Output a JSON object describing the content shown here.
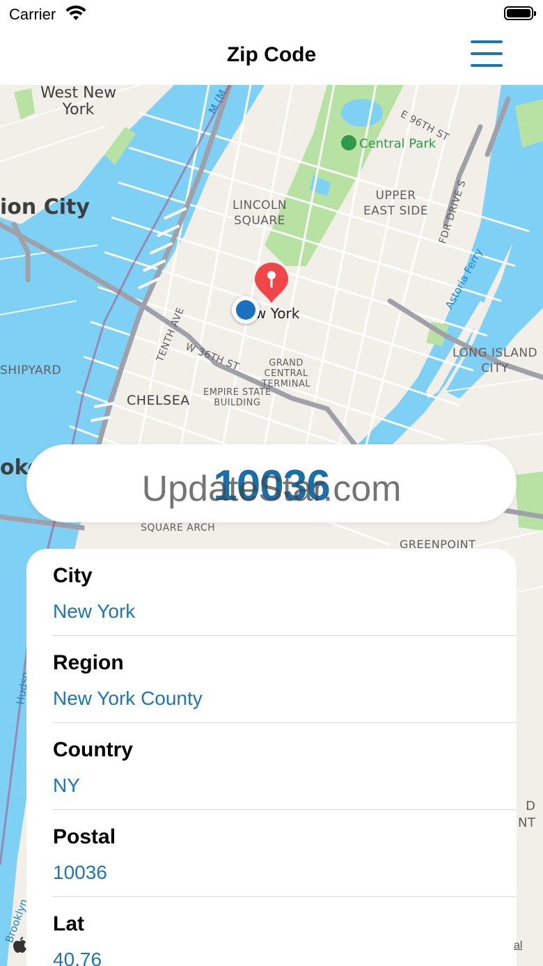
{
  "status_bar": {
    "carrier": "Carrier"
  },
  "navbar": {
    "title": "Zip Code"
  },
  "map": {
    "labels": {
      "west_new_york": "West New\nYork",
      "union_city": "ion City",
      "shipyard": "SHIPYARD",
      "hoboken": "oke",
      "lincoln_square": "LINCOLN\nSQUARE",
      "upper_east_side": "UPPER\nEAST SIDE",
      "central_park": "Central Park",
      "e96": "E 96TH ST",
      "fdr": "FDR DRIVE S",
      "astoria_ferry": "Astoria Ferry",
      "new_york": "w York",
      "tenth_ave": "TENTH AVE",
      "w36": "W 36TH ST",
      "grand_central": "GRAND\nCENTRAL\nTERMINAL",
      "empire_state": "EMPIRE STATE\nBUILDING",
      "chelsea": "CHELSEA",
      "long_island_city": "LONG ISLAND\nCITY",
      "square_arch": "SQUARE ARCH",
      "greenpoint": "GREENPOINT",
      "hudson": "Hudso",
      "brooklyn": "Brooklyn",
      "m": "M (M",
      "nt": "D\nNT",
      "legal": "al"
    },
    "colors": {
      "water": "#7ed0f4",
      "land": "#f2efe9",
      "park": "#b8e2a4",
      "road": "#ffffff",
      "highway": "#a0a0a8",
      "pin": "#f0464a",
      "location": "#1a72bf"
    }
  },
  "zip": {
    "code": "10036",
    "watermark": "UpdateStar.com"
  },
  "info": {
    "rows": [
      {
        "label": "City",
        "value": "New York"
      },
      {
        "label": "Region",
        "value": "New York County"
      },
      {
        "label": "Country",
        "value": "NY"
      },
      {
        "label": "Postal",
        "value": "10036"
      },
      {
        "label": "Lat",
        "value": "40.76"
      }
    ]
  }
}
